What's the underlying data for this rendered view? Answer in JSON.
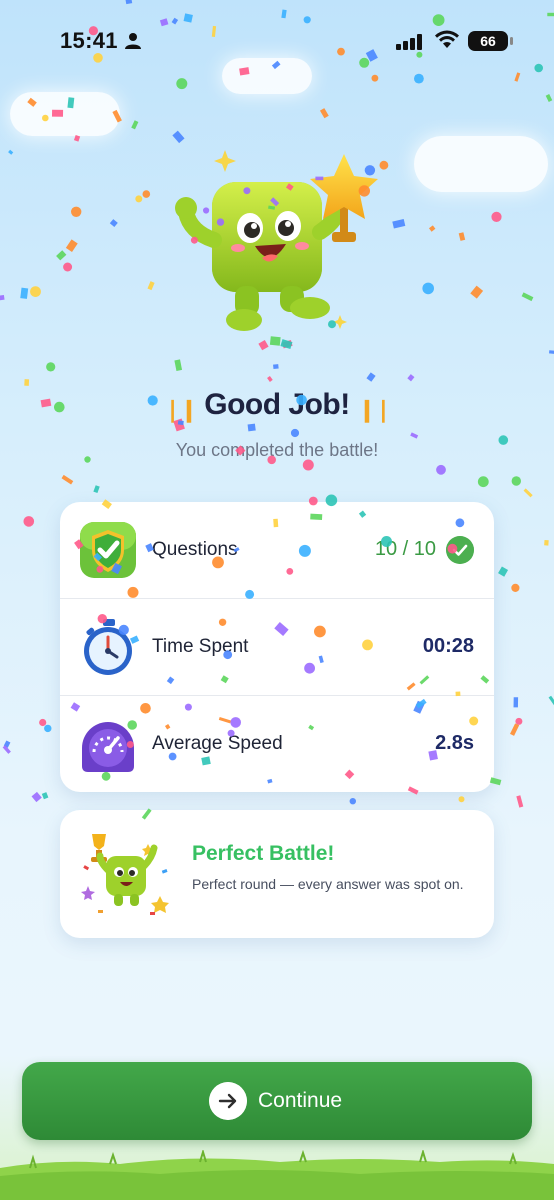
{
  "status_bar": {
    "time": "15:41",
    "battery": "66"
  },
  "result": {
    "title": "Good Job!",
    "subtitle": "You completed the battle!"
  },
  "stats": [
    {
      "label": "Questions",
      "value": "10 / 10",
      "icon": "shield-check-icon"
    },
    {
      "label": "Time Spent",
      "value": "00:28",
      "icon": "stopwatch-icon"
    },
    {
      "label": "Average Speed",
      "value": "2.8s",
      "icon": "speedometer-icon"
    }
  ],
  "perfect": {
    "title": "Perfect Battle!",
    "description": "Perfect round — every answer was spot on."
  },
  "continue_label": "Continue",
  "colors": {
    "accent_green": "#37c062",
    "button_green": "#3a9a43",
    "title_navy": "#1e2340"
  }
}
